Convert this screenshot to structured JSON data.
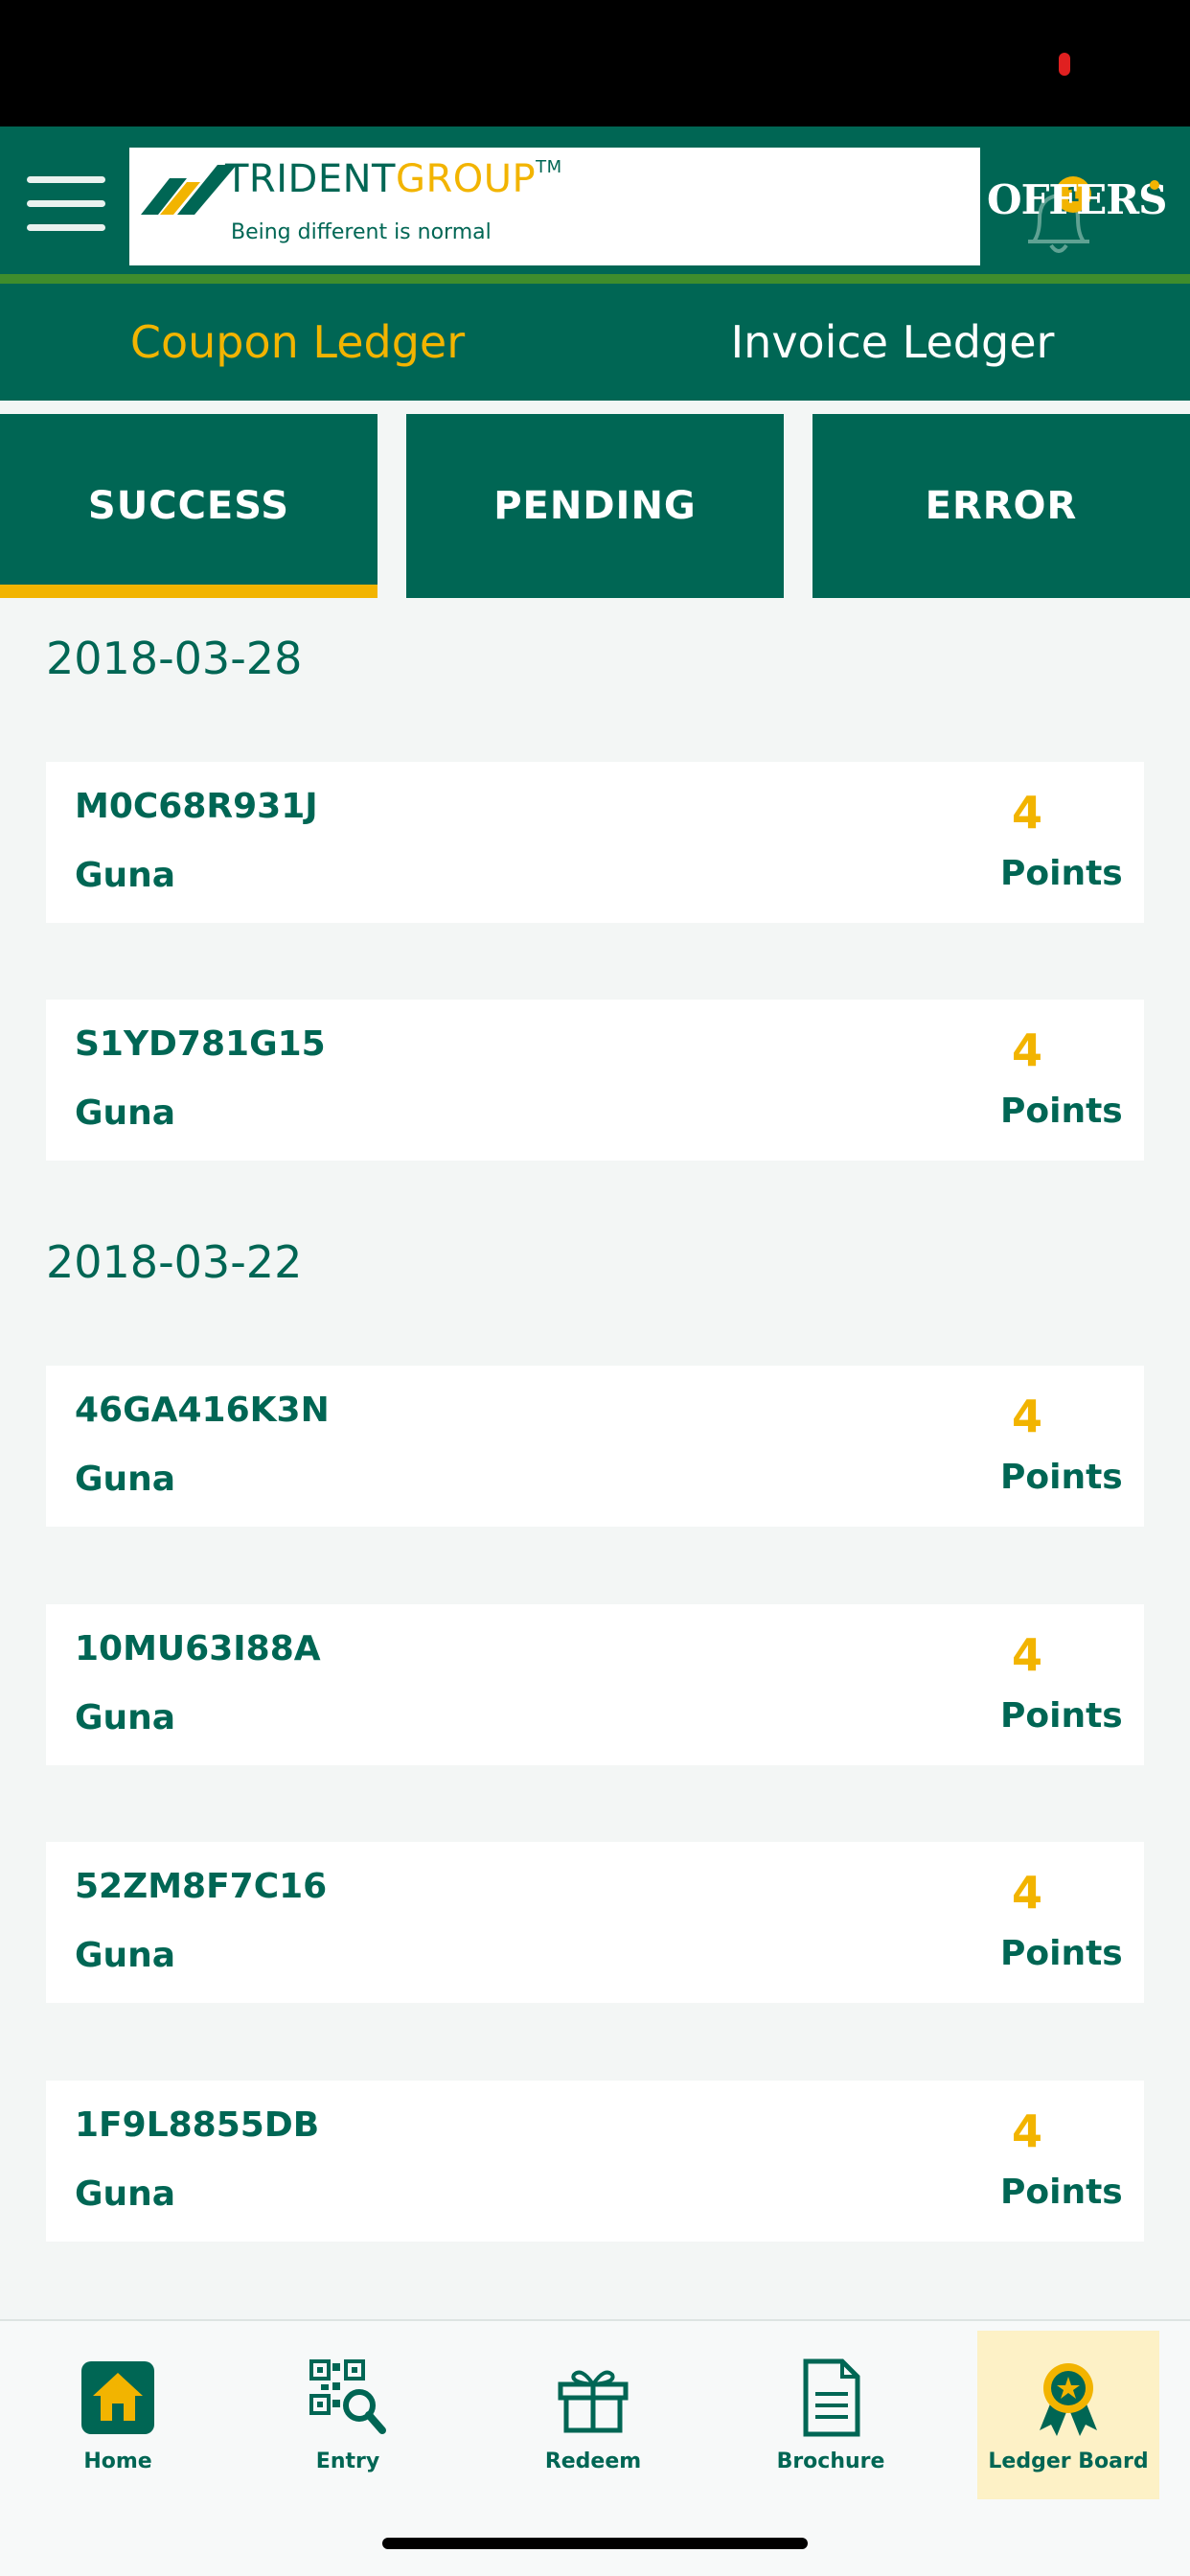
{
  "header": {
    "logo_name_part1": "TRIDENT",
    "logo_name_part2": "GROUP",
    "logo_tm": "TM",
    "logo_tagline": "Being different is normal",
    "notification_count": "1",
    "offers_label": "OFFERS"
  },
  "ledger_tabs": [
    {
      "label": "Coupon Ledger",
      "active": true
    },
    {
      "label": "Invoice Ledger",
      "active": false
    }
  ],
  "status_tabs": [
    {
      "label": "SUCCESS",
      "active": true
    },
    {
      "label": "PENDING",
      "active": false
    },
    {
      "label": "ERROR",
      "active": false
    }
  ],
  "groups": [
    {
      "date": "2018-03-28",
      "entries": [
        {
          "code": "M0C68R931J",
          "city": "Guna",
          "points": "4",
          "unit": "Points"
        },
        {
          "code": "S1YD781G15",
          "city": "Guna",
          "points": "4",
          "unit": "Points"
        }
      ]
    },
    {
      "date": "2018-03-22",
      "entries": [
        {
          "code": "46GA416K3N",
          "city": "Guna",
          "points": "4",
          "unit": "Points"
        },
        {
          "code": "10MU63I88A",
          "city": "Guna",
          "points": "4",
          "unit": "Points"
        },
        {
          "code": "52ZM8F7C16",
          "city": "Guna",
          "points": "4",
          "unit": "Points"
        },
        {
          "code": "1F9L8855DB",
          "city": "Guna",
          "points": "4",
          "unit": "Points"
        }
      ]
    }
  ],
  "bottom_nav": [
    {
      "label": "Home",
      "icon": "home-icon",
      "active": false
    },
    {
      "label": "Entry",
      "icon": "qr-scan-icon",
      "active": false
    },
    {
      "label": "Redeem",
      "icon": "gift-icon",
      "active": false
    },
    {
      "label": "Brochure",
      "icon": "document-icon",
      "active": false
    },
    {
      "label": "Ledger Board",
      "icon": "award-ribbon-icon",
      "active": true
    }
  ],
  "colors": {
    "primary": "#006654",
    "accent": "#f2b400",
    "background": "#f3f6f5",
    "active_nav_bg": "#fdf1c6"
  }
}
